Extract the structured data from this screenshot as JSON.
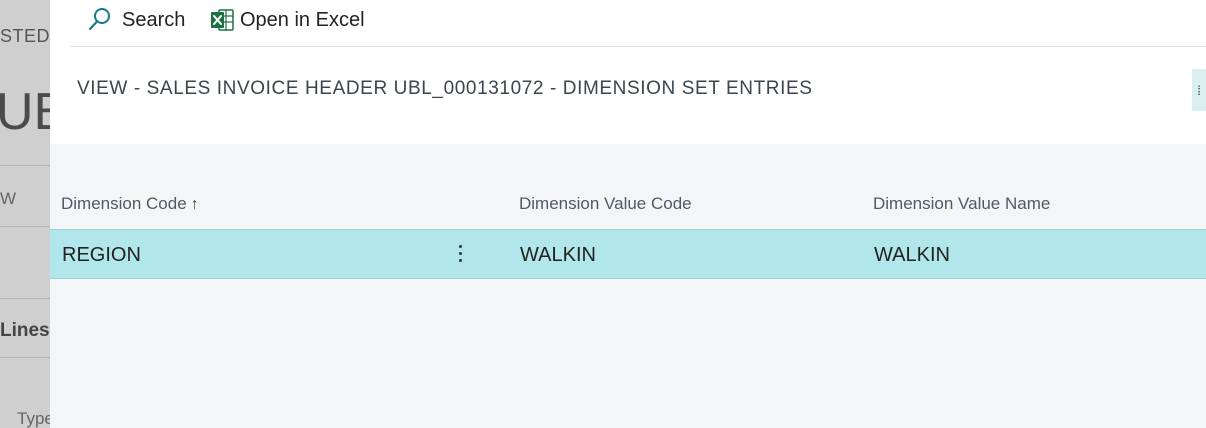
{
  "background": {
    "posted_label": "STED",
    "big_text": "UBL",
    "w_text": "W",
    "lines_label": "Lines",
    "type_label": "Type"
  },
  "actions": {
    "search_label": "Search",
    "excel_label": "Open in Excel"
  },
  "page": {
    "title": "VIEW - SALES INVOICE HEADER UBL_000131072 - DIMENSION SET ENTRIES"
  },
  "table": {
    "headers": [
      "Dimension Code",
      "Dimension Value Code",
      "Dimension Value Name"
    ],
    "sort_indicator": "↑",
    "rows": [
      [
        "REGION",
        "WALKIN",
        "WALKIN"
      ]
    ]
  },
  "colors": {
    "selected_row": "#b1e6ea",
    "excel_green": "#1e7145",
    "search_icon": "#1a7a86"
  }
}
